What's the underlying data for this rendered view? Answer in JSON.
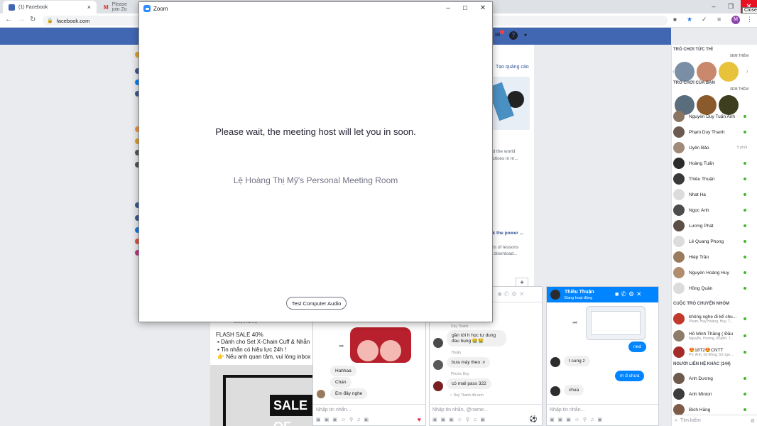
{
  "browser": {
    "tabs": [
      {
        "title": "(1) Facebook",
        "close": "×"
      },
      {
        "title": "Please join Zo",
        "close": "×"
      }
    ],
    "url": "facebook.com",
    "close_tooltip": "Close",
    "profile_initial": "M"
  },
  "zoom": {
    "title": "Zoom",
    "wait_message": "Please wait, the meeting host will let you in soon.",
    "room_name": "Lệ Hoàng Thị Mỹ's Personal Meeting Room",
    "audio_button": "Test Computer Audio",
    "minimize": "–",
    "maximize": "☐",
    "close": "✕"
  },
  "feed": {
    "ads_link": "Tạo quảng cáo",
    "snip1": "nd the world",
    "snip2": "actices in m...",
    "snip3": "ck the power ...",
    "snip4": "urs of lessons",
    "snip5": "d download...",
    "sponsored": "Được tài trợ",
    "flash": "FLASH SALE 40%",
    "bullets": [
      "Dành cho Set X-Chain Cuff & Nhẫn",
      "Tin nhắn có hiệu lực 24h !",
      "Nếu anh quan tâm, vui lòng inbox để"
    ],
    "sale_text": "SALE OF"
  },
  "right": {
    "games_now": "TRÒ CHƠI TỨC THÌ",
    "see_more1": "XEM THÊM",
    "your_games": "TRÒ CHƠI CỦA BẠN",
    "see_more2": "XEM THÊM",
    "contacts": [
      {
        "name": "Nguyễn Duy Tuấn Anh",
        "status": "online"
      },
      {
        "name": "Phạm Duy Thanh",
        "status": "online"
      },
      {
        "name": "Uyên Bảo",
        "status": "5 phút"
      },
      {
        "name": "Hoàng Tuấn",
        "status": "online"
      },
      {
        "name": "Thiều Thuận",
        "status": "online"
      },
      {
        "name": "Nhat Ha",
        "status": "online"
      },
      {
        "name": "Ngọc Ánh",
        "status": "online"
      },
      {
        "name": "Lương Phát",
        "status": "online"
      },
      {
        "name": "Lê Quang Phong",
        "status": "online"
      },
      {
        "name": "Hiệp Trần",
        "status": "online"
      },
      {
        "name": "Nguyễn Hoàng Huy",
        "status": "online"
      },
      {
        "name": "Hồng Quân",
        "status": "online"
      }
    ],
    "groups_title": "CUỘC TRÒ CHUYỆN NHÓM",
    "groups": [
      {
        "name": "không nghe đi kể chu...",
        "members": "Phạm, Huy Hoàng, Huy, T..."
      },
      {
        "name": "Hồ Minh Thắng ( Đầu",
        "members": "Nguyễn, Hương, Khánh, 7..."
      },
      {
        "name": "😍18T2😍CNTT",
        "members": "PV, Anh, Sỹ Đồng, 53 ngư..."
      }
    ],
    "others_title": "NGƯỜI LIÊN HỆ KHÁC (144)",
    "others": [
      {
        "name": "Ánh Dương"
      },
      {
        "name": "Anh Minion"
      },
      {
        "name": "Bích Hằng"
      }
    ],
    "search_placeholder": "Tìm kiếm"
  },
  "chats": [
    {
      "messages": [
        "Hahhaa",
        "Chán",
        "Em đây nghe"
      ],
      "placeholder": "Nhập tin nhắn..."
    },
    {
      "sender1": "Duy Thanh",
      "msg1": "gần tới h học tự dung đau bụng 😭😭",
      "sender2": "Thuần",
      "msg2": "bưa máy theo :v",
      "sender3": "Phước Duy",
      "msg3": "có mail pass 322",
      "seen": "✓ Duy Thanh đã xem",
      "placeholder": "Nhập tin nhắn, @name..."
    },
    {
      "name": "Thiều Thuận",
      "status": "Đang hoạt động",
      "msgs": [
        {
          "text": "ned",
          "me": true
        },
        {
          "text": "t cung z",
          "me": false
        },
        {
          "text": "m đ chưa",
          "me": true
        },
        {
          "text": "chua",
          "me": false
        }
      ],
      "placeholder": "Nhập tin nhắn..."
    }
  ],
  "colors": {
    "fb_blue": "#4267b2",
    "zoom_blue": "#2d8cff",
    "messenger_blue": "#0084ff"
  }
}
